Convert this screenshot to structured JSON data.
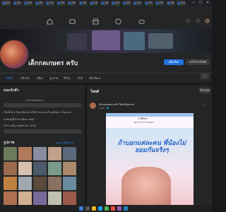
{
  "browser": {
    "tabs": [
      {
        "label": "(20"
      },
      {
        "label": "(20"
      },
      {
        "label": "(20"
      },
      {
        "label": "(20"
      },
      {
        "label": "(20"
      },
      {
        "label": "(20"
      },
      {
        "label": "(20"
      },
      {
        "label": "(20"
      },
      {
        "label": "(20"
      },
      {
        "label": "(20"
      },
      {
        "label": "(20"
      },
      {
        "label": "(20"
      },
      {
        "label": "(20"
      },
      {
        "label": "(20"
      },
      {
        "label": "(20"
      },
      {
        "label": "(20"
      },
      {
        "label": "(20"
      }
    ],
    "window_controls": [
      "—",
      "☐",
      "✕"
    ]
  },
  "profile": {
    "name": "เด็กกลเกษตร ครับ",
    "add_story_label": "เพิ่มเรื่อง",
    "edit_profile_label": "แก้ไขโปรไฟล์"
  },
  "profile_tabs": [
    "โพสต์",
    "เกี่ยวกับ",
    "เพื่อน",
    "รูปภาพ",
    "วิดีโอ",
    "รีลส์",
    "เพิ่มเติม ▾"
  ],
  "intro": {
    "title": "แนะนำตัว",
    "bio_line1": "...",
    "bio_line2": "[ แนะนำตนเอง ]",
    "detail1": "เรียนที่ มหาวิทยาลัยเทคโนโลยีราชมงคล ที่ เทคนิคการ วิทยาลัย",
    "detail2": "อาศัยอยู่ที่ อำเภอเมืองราชบุรี",
    "detail3": "เข้าร่วมเมื่อ พฤศจิกายน 2016"
  },
  "photos": {
    "title": "รูปภาพ",
    "see_all": "ดูรูปภาพทั้งหมด"
  },
  "feed": {
    "title": "โพสต์",
    "filter_label": "ตัวกรอง",
    "post": {
      "author": "เด็กกลเกษตร ครับ ได้แชร์รูปภาพ",
      "meta": "1 ชม. · 🌐",
      "img_header": "ถ้าบอกแต่ละคน พี่น้องไม่\nยอมกันจริงๆ",
      "img_top": "1 ปีที่แล้ว",
      "img_sub": "ดูความทรงจำของคุณ"
    }
  },
  "colors": {
    "fb_blue": "#2374e1",
    "bg_dark": "#18191a",
    "card_dark": "#242526"
  }
}
